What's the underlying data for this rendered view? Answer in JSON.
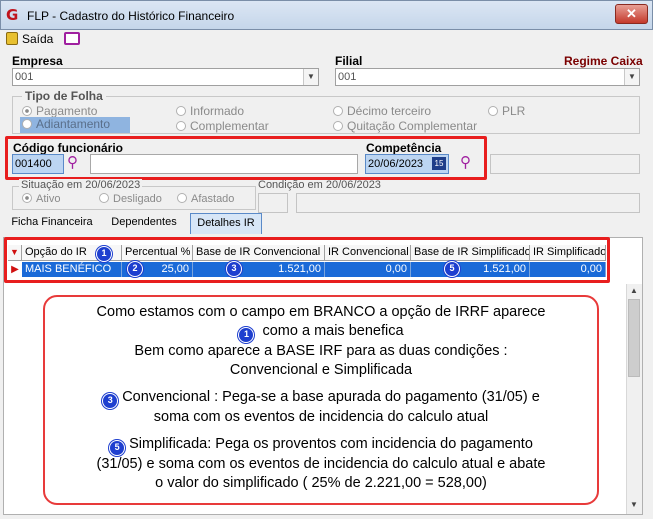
{
  "window": {
    "title": "FLP - Cadastro do Histórico Financeiro",
    "close": "✕",
    "icon_glyph": "G"
  },
  "toolbar": {
    "exit_label": "Saída"
  },
  "header": {
    "empresa_label": "Empresa",
    "empresa_value": "001",
    "filial_label": "Filial",
    "filial_value": "001",
    "regime_label": "Regime Caixa"
  },
  "tipo_folha": {
    "title": "Tipo de Folha",
    "options": [
      "Pagamento",
      "Informado",
      "Décimo terceiro",
      "PLR",
      "Adiantamento",
      "Complementar",
      "Quitação Complementar"
    ],
    "selected": "Adiantamento"
  },
  "funcionario": {
    "label": "Código funcionário",
    "code": "001400",
    "name": ""
  },
  "competencia": {
    "label": "Competência",
    "value": "20/06/2023",
    "cal": "15"
  },
  "situacao": {
    "title": "Situação em 20/06/2023",
    "options": [
      "Ativo",
      "Desligado",
      "Afastado"
    ],
    "condicao_label": "Condição em 20/06/2023"
  },
  "tabs": [
    "Ficha Financeira",
    "Dependentes",
    "Detalhes IR"
  ],
  "active_tab": "Detalhes IR",
  "grid": {
    "columns": [
      "Opção do IR",
      "Percentual %",
      "Base de IR Convencional",
      "IR Convencional",
      "Base de IR Simplificado",
      "IR Simplificado"
    ],
    "rows": [
      [
        "MAIS BENÉFICO",
        "25,00",
        "1.521,00",
        "0,00",
        "1.521,00",
        "0,00"
      ]
    ]
  },
  "badges": [
    "1",
    "2",
    "3",
    "5"
  ],
  "callout": {
    "line1": "Como estamos com o campo em BRANCO a opção de IRRF aparece",
    "line2": "como a mais benefica",
    "line3": "Bem como aparece a BASE IRF para as duas condições :",
    "line4": "Convencional e Simplificada",
    "line5": "Convencional : Pega-se a base apurada do pagamento (31/05) e",
    "line6": "soma com os eventos de incidencia do calculo atual",
    "line7": "Simplificada: Pega os proventos com incidencia do pagamento",
    "line8": "(31/05) e soma com os eventos de incidencia do calculo atual e abate",
    "line9": "o valor do simplificado ( 25% de 2.221,00 = 528,00)"
  },
  "colors": {
    "accent": "#1a6ad8",
    "highlight": "#e81e1e",
    "badge": "#1e3fcf"
  }
}
